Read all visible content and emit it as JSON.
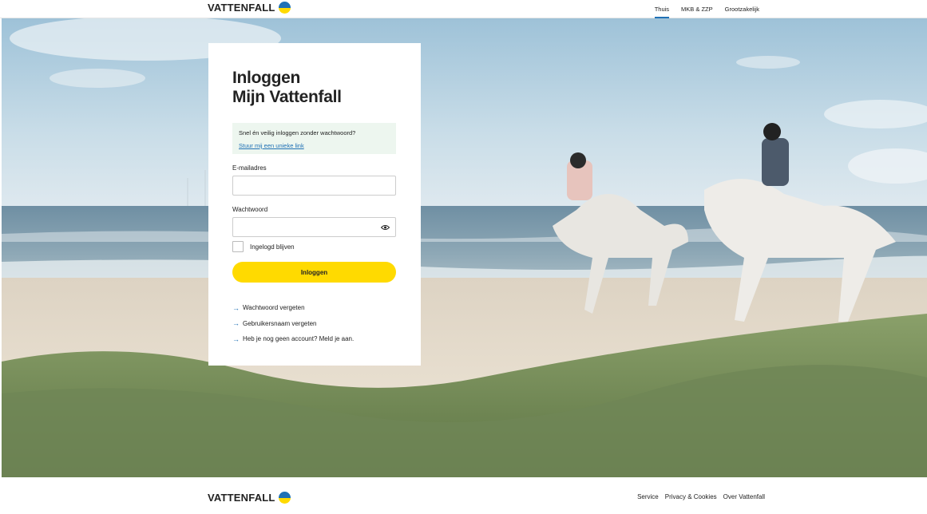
{
  "brand": {
    "name": "VATTENFALL",
    "colors": {
      "blue": "#2071b5",
      "yellow": "#ffda00"
    }
  },
  "header": {
    "nav": [
      {
        "label": "Thuis",
        "active": true
      },
      {
        "label": "MKB & ZZP",
        "active": false
      },
      {
        "label": "Grootzakelijk",
        "active": false
      }
    ]
  },
  "login": {
    "title_line1": "Inloggen",
    "title_line2": "Mijn Vattenfall",
    "notice_text": "Snel én veilig inloggen zonder wachtwoord?",
    "notice_link": "Stuur mij een unieke link",
    "email_label": "E-mailadres",
    "email_value": "",
    "password_label": "Wachtwoord",
    "password_value": "",
    "remember_label": "Ingelogd blijven",
    "remember_checked": false,
    "submit_label": "Inloggen",
    "links": [
      {
        "label": "Wachtwoord vergeten",
        "icon": "arrow-right-icon"
      },
      {
        "label": "Gebruikersnaam vergeten",
        "icon": "arrow-right-icon"
      },
      {
        "label": "Heb je nog geen account? Meld je aan.",
        "icon": "arrow-right-icon"
      }
    ]
  },
  "footer": {
    "nav": [
      {
        "label": "Service"
      },
      {
        "label": "Privacy & Cookies"
      },
      {
        "label": "Over Vattenfall"
      }
    ]
  }
}
